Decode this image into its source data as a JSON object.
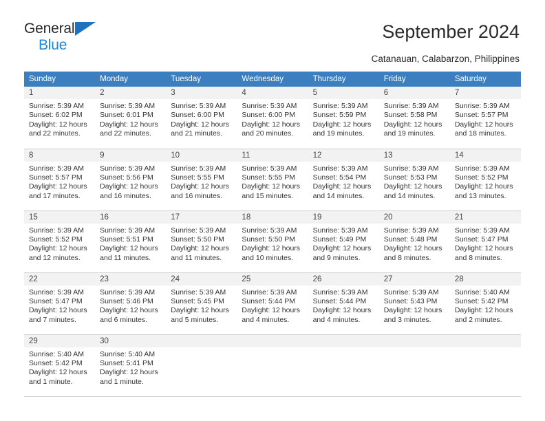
{
  "brand": {
    "name_top": "General",
    "name_bottom": "Blue",
    "accent_color": "#1f86d8",
    "triangle_color": "#1f72bd"
  },
  "header": {
    "title": "September 2024",
    "subtitle": "Catanauan, Calabarzon, Philippines"
  },
  "calendar": {
    "header_bg": "#3c7fc1",
    "daynum_bg": "#f2f2f2",
    "weekdays": [
      "Sunday",
      "Monday",
      "Tuesday",
      "Wednesday",
      "Thursday",
      "Friday",
      "Saturday"
    ],
    "labels": {
      "sunrise": "Sunrise:",
      "sunset": "Sunset:",
      "daylight": "Daylight:"
    },
    "weeks": [
      [
        {
          "day": "1",
          "sunrise": "Sunrise: 5:39 AM",
          "sunset": "Sunset: 6:02 PM",
          "daylight_line1": "Daylight: 12 hours",
          "daylight_line2": "and 22 minutes."
        },
        {
          "day": "2",
          "sunrise": "Sunrise: 5:39 AM",
          "sunset": "Sunset: 6:01 PM",
          "daylight_line1": "Daylight: 12 hours",
          "daylight_line2": "and 22 minutes."
        },
        {
          "day": "3",
          "sunrise": "Sunrise: 5:39 AM",
          "sunset": "Sunset: 6:00 PM",
          "daylight_line1": "Daylight: 12 hours",
          "daylight_line2": "and 21 minutes."
        },
        {
          "day": "4",
          "sunrise": "Sunrise: 5:39 AM",
          "sunset": "Sunset: 6:00 PM",
          "daylight_line1": "Daylight: 12 hours",
          "daylight_line2": "and 20 minutes."
        },
        {
          "day": "5",
          "sunrise": "Sunrise: 5:39 AM",
          "sunset": "Sunset: 5:59 PM",
          "daylight_line1": "Daylight: 12 hours",
          "daylight_line2": "and 19 minutes."
        },
        {
          "day": "6",
          "sunrise": "Sunrise: 5:39 AM",
          "sunset": "Sunset: 5:58 PM",
          "daylight_line1": "Daylight: 12 hours",
          "daylight_line2": "and 19 minutes."
        },
        {
          "day": "7",
          "sunrise": "Sunrise: 5:39 AM",
          "sunset": "Sunset: 5:57 PM",
          "daylight_line1": "Daylight: 12 hours",
          "daylight_line2": "and 18 minutes."
        }
      ],
      [
        {
          "day": "8",
          "sunrise": "Sunrise: 5:39 AM",
          "sunset": "Sunset: 5:57 PM",
          "daylight_line1": "Daylight: 12 hours",
          "daylight_line2": "and 17 minutes."
        },
        {
          "day": "9",
          "sunrise": "Sunrise: 5:39 AM",
          "sunset": "Sunset: 5:56 PM",
          "daylight_line1": "Daylight: 12 hours",
          "daylight_line2": "and 16 minutes."
        },
        {
          "day": "10",
          "sunrise": "Sunrise: 5:39 AM",
          "sunset": "Sunset: 5:55 PM",
          "daylight_line1": "Daylight: 12 hours",
          "daylight_line2": "and 16 minutes."
        },
        {
          "day": "11",
          "sunrise": "Sunrise: 5:39 AM",
          "sunset": "Sunset: 5:55 PM",
          "daylight_line1": "Daylight: 12 hours",
          "daylight_line2": "and 15 minutes."
        },
        {
          "day": "12",
          "sunrise": "Sunrise: 5:39 AM",
          "sunset": "Sunset: 5:54 PM",
          "daylight_line1": "Daylight: 12 hours",
          "daylight_line2": "and 14 minutes."
        },
        {
          "day": "13",
          "sunrise": "Sunrise: 5:39 AM",
          "sunset": "Sunset: 5:53 PM",
          "daylight_line1": "Daylight: 12 hours",
          "daylight_line2": "and 14 minutes."
        },
        {
          "day": "14",
          "sunrise": "Sunrise: 5:39 AM",
          "sunset": "Sunset: 5:52 PM",
          "daylight_line1": "Daylight: 12 hours",
          "daylight_line2": "and 13 minutes."
        }
      ],
      [
        {
          "day": "15",
          "sunrise": "Sunrise: 5:39 AM",
          "sunset": "Sunset: 5:52 PM",
          "daylight_line1": "Daylight: 12 hours",
          "daylight_line2": "and 12 minutes."
        },
        {
          "day": "16",
          "sunrise": "Sunrise: 5:39 AM",
          "sunset": "Sunset: 5:51 PM",
          "daylight_line1": "Daylight: 12 hours",
          "daylight_line2": "and 11 minutes."
        },
        {
          "day": "17",
          "sunrise": "Sunrise: 5:39 AM",
          "sunset": "Sunset: 5:50 PM",
          "daylight_line1": "Daylight: 12 hours",
          "daylight_line2": "and 11 minutes."
        },
        {
          "day": "18",
          "sunrise": "Sunrise: 5:39 AM",
          "sunset": "Sunset: 5:50 PM",
          "daylight_line1": "Daylight: 12 hours",
          "daylight_line2": "and 10 minutes."
        },
        {
          "day": "19",
          "sunrise": "Sunrise: 5:39 AM",
          "sunset": "Sunset: 5:49 PM",
          "daylight_line1": "Daylight: 12 hours",
          "daylight_line2": "and 9 minutes."
        },
        {
          "day": "20",
          "sunrise": "Sunrise: 5:39 AM",
          "sunset": "Sunset: 5:48 PM",
          "daylight_line1": "Daylight: 12 hours",
          "daylight_line2": "and 8 minutes."
        },
        {
          "day": "21",
          "sunrise": "Sunrise: 5:39 AM",
          "sunset": "Sunset: 5:47 PM",
          "daylight_line1": "Daylight: 12 hours",
          "daylight_line2": "and 8 minutes."
        }
      ],
      [
        {
          "day": "22",
          "sunrise": "Sunrise: 5:39 AM",
          "sunset": "Sunset: 5:47 PM",
          "daylight_line1": "Daylight: 12 hours",
          "daylight_line2": "and 7 minutes."
        },
        {
          "day": "23",
          "sunrise": "Sunrise: 5:39 AM",
          "sunset": "Sunset: 5:46 PM",
          "daylight_line1": "Daylight: 12 hours",
          "daylight_line2": "and 6 minutes."
        },
        {
          "day": "24",
          "sunrise": "Sunrise: 5:39 AM",
          "sunset": "Sunset: 5:45 PM",
          "daylight_line1": "Daylight: 12 hours",
          "daylight_line2": "and 5 minutes."
        },
        {
          "day": "25",
          "sunrise": "Sunrise: 5:39 AM",
          "sunset": "Sunset: 5:44 PM",
          "daylight_line1": "Daylight: 12 hours",
          "daylight_line2": "and 4 minutes."
        },
        {
          "day": "26",
          "sunrise": "Sunrise: 5:39 AM",
          "sunset": "Sunset: 5:44 PM",
          "daylight_line1": "Daylight: 12 hours",
          "daylight_line2": "and 4 minutes."
        },
        {
          "day": "27",
          "sunrise": "Sunrise: 5:39 AM",
          "sunset": "Sunset: 5:43 PM",
          "daylight_line1": "Daylight: 12 hours",
          "daylight_line2": "and 3 minutes."
        },
        {
          "day": "28",
          "sunrise": "Sunrise: 5:40 AM",
          "sunset": "Sunset: 5:42 PM",
          "daylight_line1": "Daylight: 12 hours",
          "daylight_line2": "and 2 minutes."
        }
      ],
      [
        {
          "day": "29",
          "sunrise": "Sunrise: 5:40 AM",
          "sunset": "Sunset: 5:42 PM",
          "daylight_line1": "Daylight: 12 hours",
          "daylight_line2": "and 1 minute."
        },
        {
          "day": "30",
          "sunrise": "Sunrise: 5:40 AM",
          "sunset": "Sunset: 5:41 PM",
          "daylight_line1": "Daylight: 12 hours",
          "daylight_line2": "and 1 minute."
        },
        {
          "day": "",
          "sunrise": "",
          "sunset": "",
          "daylight_line1": "",
          "daylight_line2": ""
        },
        {
          "day": "",
          "sunrise": "",
          "sunset": "",
          "daylight_line1": "",
          "daylight_line2": ""
        },
        {
          "day": "",
          "sunrise": "",
          "sunset": "",
          "daylight_line1": "",
          "daylight_line2": ""
        },
        {
          "day": "",
          "sunrise": "",
          "sunset": "",
          "daylight_line1": "",
          "daylight_line2": ""
        },
        {
          "day": "",
          "sunrise": "",
          "sunset": "",
          "daylight_line1": "",
          "daylight_line2": ""
        }
      ]
    ]
  }
}
